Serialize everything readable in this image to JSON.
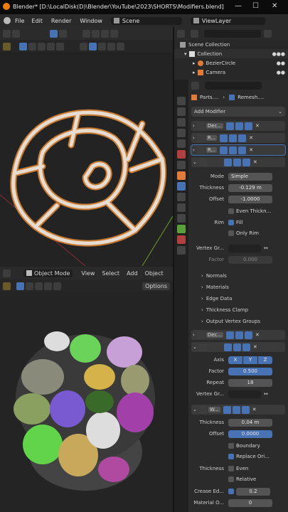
{
  "window": {
    "title": "Blender* [D:\\LocalDisk(D)\\Blender\\YouTube\\2023\\SHORTS\\Modifiers.blend]",
    "minimize": "—",
    "maximize": "☐",
    "close": "✕"
  },
  "menu": {
    "file": "File",
    "edit": "Edit",
    "render": "Render",
    "window": "Window",
    "scene": "Scene",
    "viewlayer": "ViewLayer"
  },
  "outliner": {
    "scene_collection": "Scene Collection",
    "collection": "Collection",
    "items": [
      "BezierCircle",
      "Camera"
    ]
  },
  "viewport_bottom": {
    "mode": "Object Mode",
    "view": "View",
    "select": "Select",
    "add": "Add",
    "object": "Object",
    "options": "Options"
  },
  "properties": {
    "breadcrumb_object": "Parts....",
    "breadcrumb_mod": "Remesh....",
    "add_modifier": "Add Modifier",
    "modifiers": [
      {
        "name": "Dec..."
      },
      {
        "name": "R..."
      },
      {
        "name": "R..."
      },
      {
        "name": ""
      }
    ],
    "solidify": {
      "mode_label": "Mode",
      "mode_value": "Simple",
      "thickness_label": "Thickness",
      "thickness_value": "-0.129 m",
      "offset_label": "Offset",
      "offset_value": "-1.0000",
      "even_thickness": "Even Thickn...",
      "rim_label": "Rim",
      "fill": "Fill",
      "only_rim": "Only Rim",
      "vertex_group_label": "Vertex Gr...",
      "factor_label": "Factor",
      "factor_value": "0.000",
      "sections": [
        "Normals",
        "Materials",
        "Edge Data",
        "Thickness Clamp",
        "Output Vertex Groups"
      ]
    },
    "decimate2_name": "Dec...",
    "deform": {
      "axis_label": "Axis",
      "axes": [
        "X",
        "Y",
        "Z"
      ],
      "factor_label": "Factor",
      "factor_value": "0.500",
      "repeat_label": "Repeat",
      "repeat_value": "18",
      "vertex_group_label": "Vertex Gr..."
    },
    "wireframe": {
      "name": "W...",
      "thickness_label": "Thickness",
      "thickness_value": "0.04 m",
      "offset_label": "Offset",
      "offset_value": "0.0000",
      "boundary": "Boundary",
      "replace_original": "Replace Ori...",
      "thickness2_label": "Thickness",
      "even": "Even",
      "relative": "Relative",
      "crease_label": "Crease Ed...",
      "crease_value": "0.2",
      "material_label": "Material O...",
      "material_value": "0"
    }
  },
  "colors": {
    "accent": "#4772b3",
    "panel": "#2b2b2b",
    "viewport": "#232323"
  }
}
